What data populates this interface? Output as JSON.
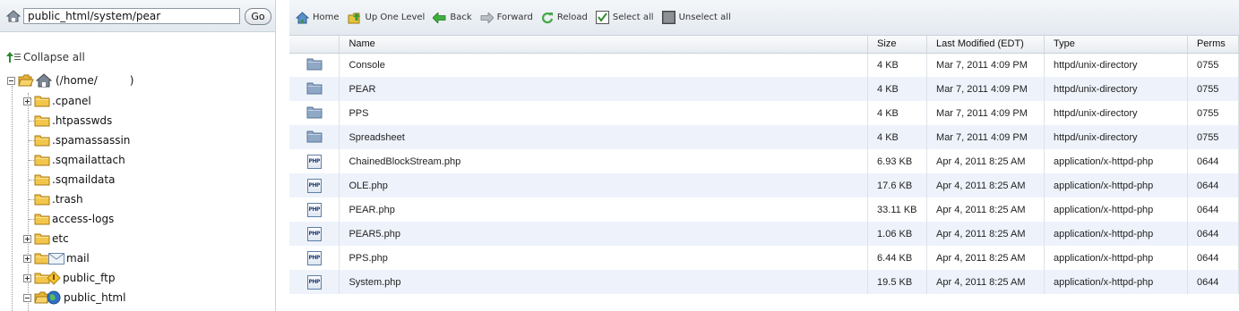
{
  "path_bar": {
    "value": "public_html/system/pear",
    "go_label": "Go"
  },
  "tree": {
    "collapse_label": "Collapse all",
    "root_label": "(/home/",
    "root_suffix": ")",
    "items": [
      {
        "label": ".cpanel",
        "expander": "plus"
      },
      {
        "label": ".htpasswds",
        "expander": "none"
      },
      {
        "label": ".spamassassin",
        "expander": "none"
      },
      {
        "label": ".sqmailattach",
        "expander": "none"
      },
      {
        "label": ".sqmaildata",
        "expander": "none"
      },
      {
        "label": ".trash",
        "expander": "none"
      },
      {
        "label": "access-logs",
        "expander": "none"
      },
      {
        "label": "etc",
        "expander": "plus"
      },
      {
        "label": "mail",
        "expander": "plus"
      },
      {
        "label": "public_ftp",
        "expander": "plus"
      },
      {
        "label": "public_html",
        "expander": "minus"
      }
    ]
  },
  "toolbar": {
    "home": "Home",
    "up_one_level": "Up One Level",
    "back": "Back",
    "forward": "Forward",
    "reload": "Reload",
    "select_all": "Select all",
    "unselect_all": "Unselect all"
  },
  "table": {
    "headers": {
      "name": "Name",
      "size": "Size",
      "modified": "Last Modified (EDT)",
      "type": "Type",
      "perms": "Perms"
    },
    "rows": [
      {
        "icon": "folder-icon",
        "name": "Console",
        "size": "4 KB",
        "modified": "Mar 7, 2011 4:09 PM",
        "type": "httpd/unix-directory",
        "perms": "0755"
      },
      {
        "icon": "folder-icon",
        "name": "PEAR",
        "size": "4 KB",
        "modified": "Mar 7, 2011 4:09 PM",
        "type": "httpd/unix-directory",
        "perms": "0755"
      },
      {
        "icon": "folder-icon",
        "name": "PPS",
        "size": "4 KB",
        "modified": "Mar 7, 2011 4:09 PM",
        "type": "httpd/unix-directory",
        "perms": "0755"
      },
      {
        "icon": "folder-icon",
        "name": "Spreadsheet",
        "size": "4 KB",
        "modified": "Mar 7, 2011 4:09 PM",
        "type": "httpd/unix-directory",
        "perms": "0755"
      },
      {
        "icon": "php-file-icon",
        "name": "ChainedBlockStream.php",
        "size": "6.93 KB",
        "modified": "Apr 4, 2011 8:25 AM",
        "type": "application/x-httpd-php",
        "perms": "0644"
      },
      {
        "icon": "php-file-icon",
        "name": "OLE.php",
        "size": "17.6 KB",
        "modified": "Apr 4, 2011 8:25 AM",
        "type": "application/x-httpd-php",
        "perms": "0644"
      },
      {
        "icon": "php-file-icon",
        "name": "PEAR.php",
        "size": "33.11 KB",
        "modified": "Apr 4, 2011 8:25 AM",
        "type": "application/x-httpd-php",
        "perms": "0644"
      },
      {
        "icon": "php-file-icon",
        "name": "PEAR5.php",
        "size": "1.06 KB",
        "modified": "Apr 4, 2011 8:25 AM",
        "type": "application/x-httpd-php",
        "perms": "0644"
      },
      {
        "icon": "php-file-icon",
        "name": "PPS.php",
        "size": "6.44 KB",
        "modified": "Apr 4, 2011 8:25 AM",
        "type": "application/x-httpd-php",
        "perms": "0644"
      },
      {
        "icon": "php-file-icon",
        "name": "System.php",
        "size": "19.5 KB",
        "modified": "Apr 4, 2011 8:25 AM",
        "type": "application/x-httpd-php",
        "perms": "0644"
      }
    ]
  },
  "php_icon_text": "PHP"
}
